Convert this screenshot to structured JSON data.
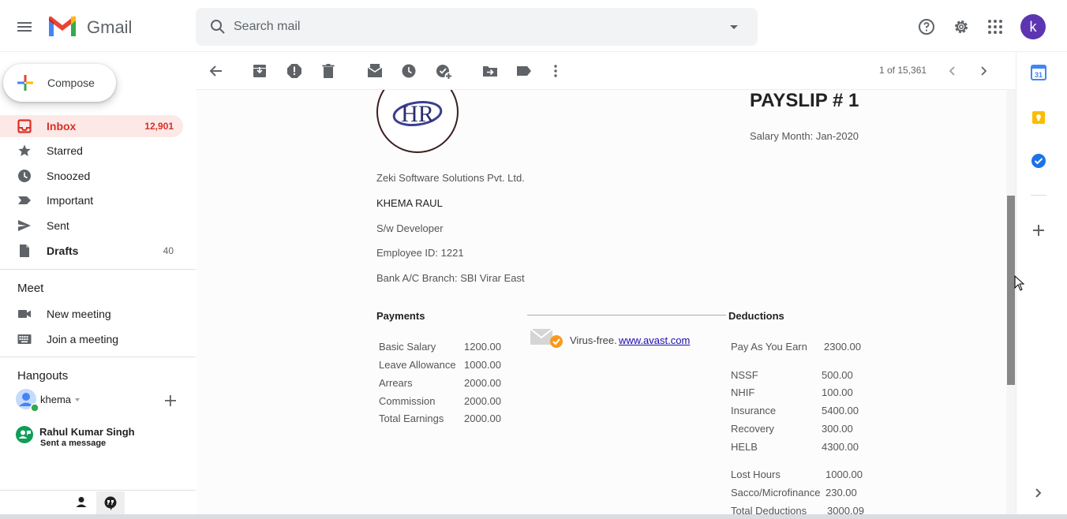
{
  "header": {
    "app_name": "Gmail",
    "search_placeholder": "Search mail",
    "avatar_letter": "k"
  },
  "compose_label": "Compose",
  "nav": {
    "items": [
      {
        "label": "Inbox",
        "count": "12,901",
        "icon": "inbox-icon"
      },
      {
        "label": "Starred",
        "count": "",
        "icon": "star-icon"
      },
      {
        "label": "Snoozed",
        "count": "",
        "icon": "clock-icon"
      },
      {
        "label": "Important",
        "count": "",
        "icon": "important-icon"
      },
      {
        "label": "Sent",
        "count": "",
        "icon": "send-icon"
      },
      {
        "label": "Drafts",
        "count": "40",
        "icon": "draft-icon"
      }
    ],
    "meet_title": "Meet",
    "meet_items": [
      {
        "label": "New meeting",
        "icon": "video-icon"
      },
      {
        "label": "Join a meeting",
        "icon": "keyboard-icon"
      }
    ],
    "hangouts_title": "Hangouts",
    "hangouts_user": "khema",
    "contact": {
      "name": "Rahul Kumar Singh",
      "status": "Sent a message"
    }
  },
  "toolbar": {
    "page_counter": "1 of 15,361"
  },
  "email": {
    "title": "PAYSLIP # 1",
    "salary_month": "Salary Month: Jan-2020",
    "company": "Zeki Software Solutions Pvt. Ltd.",
    "employee_name": "KHEMA RAUL",
    "designation": "S/w Developer",
    "employee_id": "Employee ID: 1221",
    "bank_branch": "Bank A/C Branch: SBI Virar East",
    "payments_title": "Payments",
    "payments": [
      {
        "label": "Basic Salary",
        "value": "1200.00"
      },
      {
        "label": "Leave Allowance",
        "value": "1000.00"
      },
      {
        "label": "Arrears",
        "value": "2000.00"
      },
      {
        "label": "Commission",
        "value": "2000.00"
      },
      {
        "label": "Total Earnings",
        "value": "2000.00"
      }
    ],
    "virus_free": "Virus-free.",
    "avast_link": "www.avast.com",
    "deductions_title": "Deductions",
    "paye": {
      "label": "Pay As You Earn",
      "value": "2300.00"
    },
    "deductions": [
      {
        "label": "NSSF",
        "value": "500.00"
      },
      {
        "label": "NHIF",
        "value": "100.00"
      },
      {
        "label": "Insurance",
        "value": "5400.00"
      },
      {
        "label": "Recovery",
        "value": "300.00"
      },
      {
        "label": "HELB",
        "value": "4300.00"
      }
    ],
    "deductions_extra": [
      {
        "label": "Lost Hours",
        "value": "1000.00"
      },
      {
        "label": "Sacco/Microfinance",
        "value": "230.00"
      },
      {
        "label": "Total Deductions",
        "value": "3000.09"
      }
    ]
  },
  "colors": {
    "accent": "#d93025",
    "avatar": "#5e35b1",
    "active_bg": "#fce8e6"
  }
}
